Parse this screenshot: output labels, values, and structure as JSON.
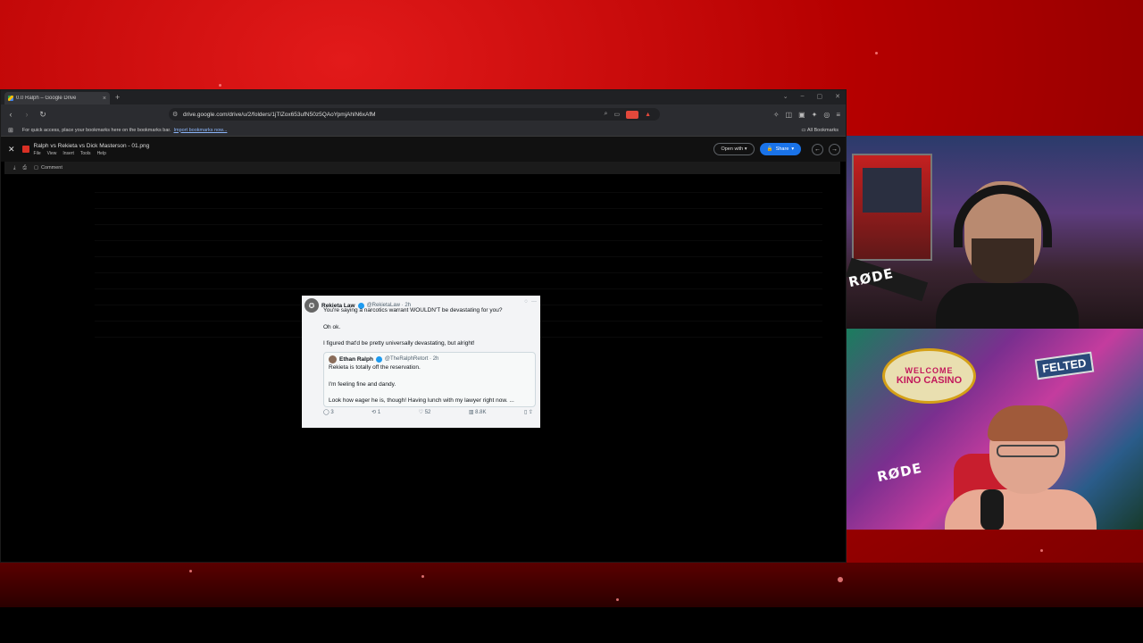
{
  "browser": {
    "tab_title": "0.0 Ralph – Google Drive",
    "tab_close": "×",
    "new_tab": "+",
    "window_controls": [
      "⌄",
      "–",
      "▢",
      "✕"
    ],
    "url": "drive.google.com/drive/u/2/folders/1jTlZox653ufN50z5QAoYpmjAhlN6xAfM",
    "bookmarks_prompt": "For quick access, place your bookmarks here on the bookmarks bar.",
    "bookmarks_link": "Import bookmarks now...",
    "all_bookmarks": "All Bookmarks"
  },
  "viewer": {
    "file_name": "Ralph vs Rekieta vs Dick Masterson - 01.png",
    "menu": [
      "File",
      "View",
      "Insert",
      "Tools",
      "Help"
    ],
    "open_with": "Open with",
    "share": "Share",
    "comment": "Comment"
  },
  "tweet": {
    "author": "Rekieta Law",
    "handle": "@RekietaLaw · 2h",
    "line1": "You're saying a narcotics warrant WOULDN'T be devastating for you?",
    "line2": "Oh ok.",
    "line3": "I figured that'd be pretty universally devastating, but alright!",
    "quote": {
      "author": "Ethan Ralph",
      "handle": "@TheRalphRetort · 2h",
      "line1": "Rekieta is totally off the reservation.",
      "line2": "I'm feeling fine and dandy.",
      "line3": "Look how eager he is, though! Having lunch with my lawyer right now. ..."
    },
    "actions": {
      "replies": "3",
      "reposts": "1",
      "likes": "52",
      "views": "8.8K"
    }
  },
  "overlay": {
    "rode_label": "RØDE",
    "casino_welcome": "WELCOME",
    "casino_name": "KINO CASINO",
    "felted_sign": "FELTED"
  }
}
